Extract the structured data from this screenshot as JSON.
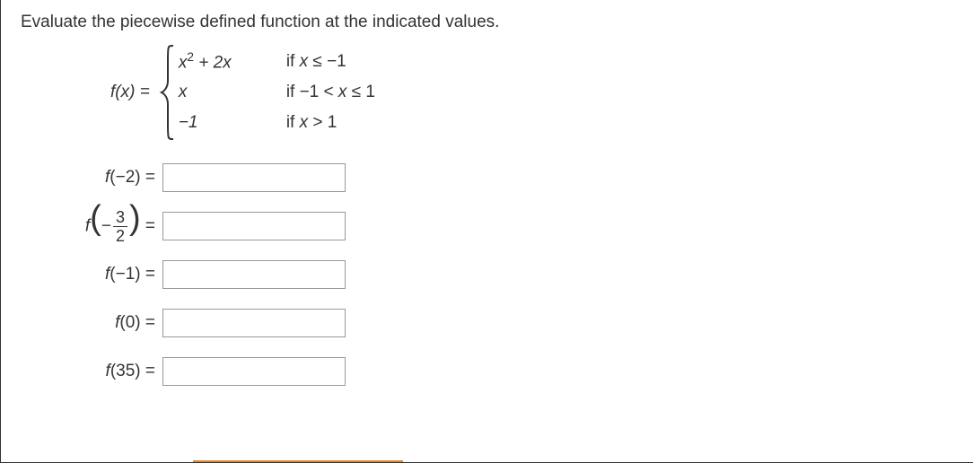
{
  "prompt": "Evaluate the piecewise defined function at the indicated values.",
  "function": {
    "lhs": "f(x) = ",
    "pieces": [
      {
        "expr_html": "x<span class='sup'>2</span> + 2x",
        "cond_html": "if <span class='xvar'>x</span> ≤ −1"
      },
      {
        "expr_html": "x",
        "cond_html": "if −1 < <span class='xvar'>x</span> ≤ 1"
      },
      {
        "expr_html": "−1",
        "cond_html": "if <span class='xvar'>x</span> > 1"
      }
    ]
  },
  "inputs": [
    {
      "label_html": "f<span class='paren'>(</span><span class='num'>−2</span><span class='paren'>)</span> <span class='eq'>=</span>",
      "value": ""
    },
    {
      "label_html": "f<span class='bigparen'>(</span><span class='num'>−</span><span class='frac'><span class='fnum'>3</span><span class='fden'>2</span></span><span class='bigparen'>)</span> <span class='eq'>=</span>",
      "value": ""
    },
    {
      "label_html": "f<span class='paren'>(</span><span class='num'>−1</span><span class='paren'>)</span> <span class='eq'>=</span>",
      "value": ""
    },
    {
      "label_html": "f<span class='paren'>(</span><span class='num'>0</span><span class='paren'>)</span> <span class='eq'>=</span>",
      "value": ""
    },
    {
      "label_html": "f<span class='paren'>(</span><span class='num'>35</span><span class='paren'>)</span> <span class='eq'>=</span>",
      "value": ""
    }
  ]
}
